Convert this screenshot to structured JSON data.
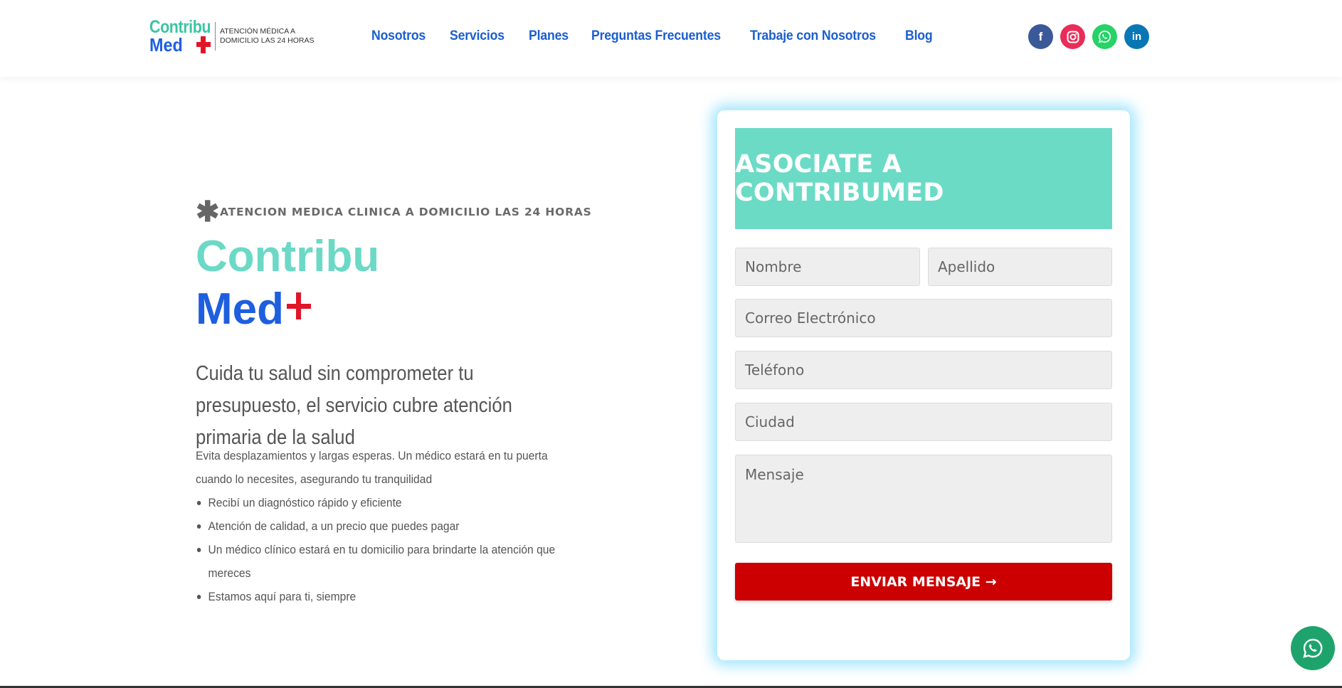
{
  "header": {
    "logo": {
      "line1": "Contribu",
      "line2": "Med",
      "tagline": "ATENCIÓN MÉDICA A DOMICILIO LAS 24 HORAS"
    },
    "nav": [
      {
        "label": "Nosotros"
      },
      {
        "label": "Servicios"
      },
      {
        "label": "Planes"
      },
      {
        "label": "Preguntas Frecuentes"
      },
      {
        "label": "Trabaje con Nosotros"
      },
      {
        "label": "Blog"
      }
    ],
    "social": {
      "facebook": "f",
      "linkedin": "in"
    }
  },
  "hero": {
    "eyebrow": "ATENCION MEDICA CLINICA A DOMICILIO LAS 24 HORAS",
    "brand_line1": "Contribu",
    "brand_line2": "Med",
    "subheading": "Cuida tu salud sin comprometer tu presupuesto, el servicio cubre atención primaria de la salud",
    "intro": "Evita desplazamientos y largas esperas. Un médico estará en tu puerta cuando lo necesites, asegurando tu tranquilidad",
    "bullets": [
      "Recibí un diagnóstico rápido y eficiente",
      "Atención de calidad, a un precio que puedes pagar",
      "Un médico clínico estará en tu domicilio para brindarte la atención que mereces",
      "Estamos aquí para ti, siempre"
    ]
  },
  "form": {
    "title": "ASOCIATE A CONTRIBUMED",
    "fields": {
      "nombre": "Nombre",
      "apellido": "Apellido",
      "correo": "Correo Electrónico",
      "telefono": "Teléfono",
      "ciudad": "Ciudad",
      "mensaje": "Mensaje"
    },
    "submit": "ENVIAR MENSAJE →"
  },
  "colors": {
    "nav": "#1b5fcf",
    "brand_teal": "#6bd9c5",
    "brand_blue": "#1e5fe0",
    "brand_red": "#e11528",
    "form_header": "#6bdbc6",
    "submit": "#cc0000",
    "glow": "#5ad2fa"
  },
  "icons": [
    "facebook-icon",
    "instagram-icon",
    "whatsapp-icon",
    "linkedin-icon",
    "asterisk-icon",
    "whatsapp-float-icon"
  ]
}
